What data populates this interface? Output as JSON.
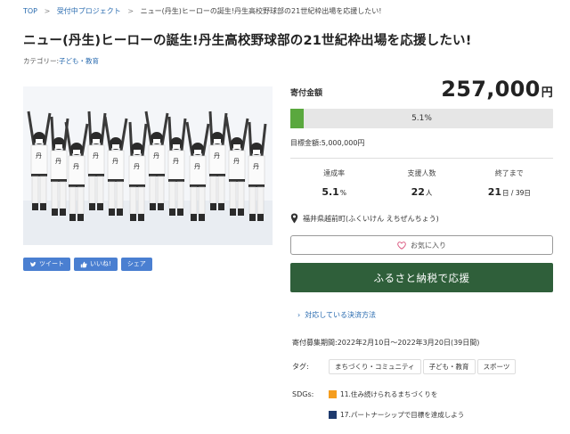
{
  "breadcrumb": {
    "top": "TOP",
    "sep": ">",
    "projects": "受付中プロジェクト",
    "current": "ニュー(丹生)ヒーローの誕生!丹生高校野球部の21世紀枠出場を応援したい!"
  },
  "title": "ニュー(丹生)ヒーローの誕生!丹生高校野球部の21世紀枠出場を応援したい!",
  "category": {
    "label": "カテゴリー:",
    "value": "子ども・教育"
  },
  "share": {
    "tweet": "ツイート",
    "like": "いいね!",
    "share": "シェア"
  },
  "donation": {
    "label": "寄付金額",
    "amount": "257,000",
    "unit": "円",
    "progress_percent": 5.1,
    "progress_text": "5.1%",
    "goal": "目標金額:5,000,000円"
  },
  "stats": [
    {
      "label": "達成率",
      "value": "5.1",
      "unit": "%"
    },
    {
      "label": "支援人数",
      "value": "22",
      "unit": "人"
    },
    {
      "label": "終了まで",
      "value": "21",
      "unit": "日 / 39日"
    }
  ],
  "location": "福井県越前町(ふくいけん えちぜんちょう)",
  "favorite_label": "お気に入り",
  "donate_label": "ふるさと納税で応援",
  "payment_link": "対応している決済方法",
  "period": "寄付募集期間:2022年2月10日～2022年3月20日(39日間)",
  "tags": {
    "label": "タグ:",
    "items": [
      "まちづくり・コミュニティ",
      "子ども・教育",
      "スポーツ"
    ]
  },
  "sdgs": {
    "label": "SDGs:",
    "items": [
      {
        "label": "11.住み続けられるまちづくりを",
        "color": "#f59d1e"
      },
      {
        "label": "17.パートナーシップで目標を達成しよう",
        "color": "#1e3a6e"
      }
    ]
  },
  "colors": {
    "link": "#2b6cb0",
    "progress_fill": "#5aa83e",
    "donate_button": "#2f5f3a",
    "share_button": "#4a7fd1"
  }
}
